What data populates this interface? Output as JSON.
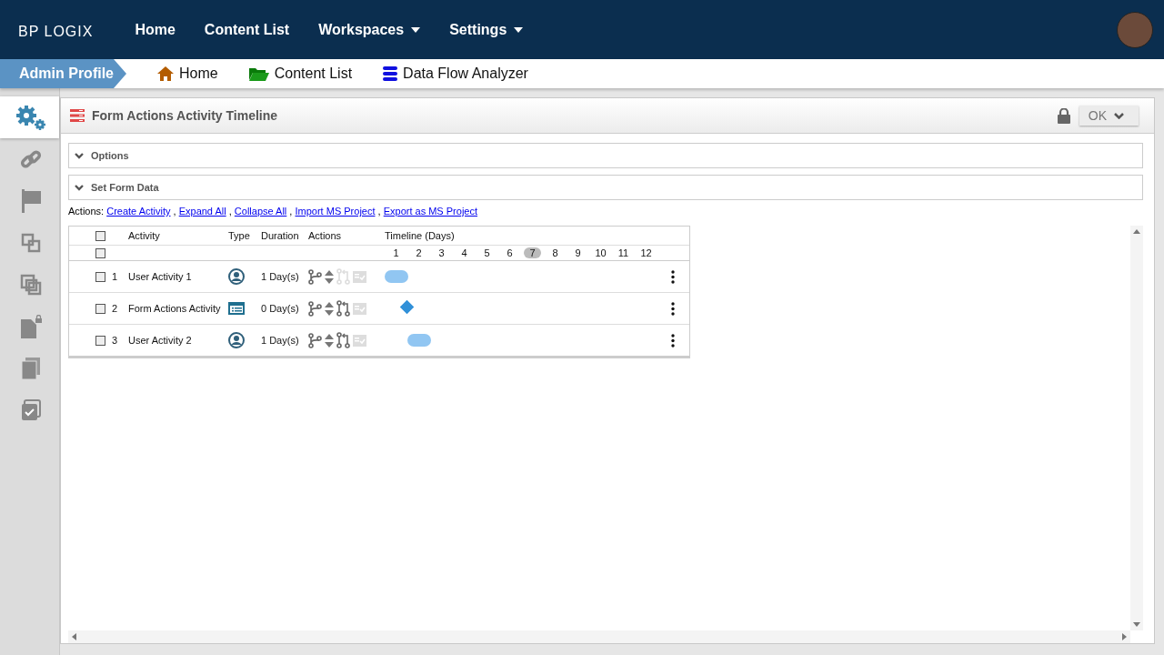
{
  "top_nav": {
    "logo": "BP LOGIX",
    "items": [
      {
        "label": "Home",
        "has_menu": false
      },
      {
        "label": "Content List",
        "has_menu": false
      },
      {
        "label": "Workspaces",
        "has_menu": true
      },
      {
        "label": "Settings",
        "has_menu": true
      }
    ]
  },
  "breadcrumb": {
    "profile": "Admin Profile",
    "links": [
      {
        "label": "Home",
        "kind": "home"
      },
      {
        "label": "Content List",
        "kind": "folder"
      },
      {
        "label": "Data Flow Analyzer",
        "kind": "database"
      }
    ]
  },
  "sidebar": {
    "items": [
      {
        "kind": "gears",
        "selected": true
      },
      {
        "kind": "link",
        "selected": false
      },
      {
        "kind": "flag",
        "selected": false
      },
      {
        "kind": "squares",
        "selected": false
      },
      {
        "kind": "squares2",
        "selected": false
      },
      {
        "kind": "filelock",
        "selected": false
      },
      {
        "kind": "copy",
        "selected": false
      },
      {
        "kind": "check",
        "selected": false
      }
    ]
  },
  "panel": {
    "title": "Form Actions Activity Timeline",
    "ok_button": "OK",
    "sections": [
      "Options",
      "Set Form Data"
    ],
    "actions_label": "Actions:",
    "actions_separator": ",",
    "actions": [
      "Create Activity",
      "Expand All",
      "Collapse All",
      "Import MS Project",
      "Export as MS Project"
    ],
    "table": {
      "columns": [
        "Activity",
        "Type",
        "Duration",
        "Actions",
        "Timeline (Days)"
      ],
      "header_checked": false,
      "subheader_checked": false,
      "days": [
        {
          "label": "1",
          "selected": false
        },
        {
          "label": "2",
          "selected": false
        },
        {
          "label": "3",
          "selected": false
        },
        {
          "label": "4",
          "selected": false
        },
        {
          "label": "5",
          "selected": false
        },
        {
          "label": "6",
          "selected": false
        },
        {
          "label": "7",
          "selected": true
        },
        {
          "label": "8",
          "selected": false
        },
        {
          "label": "9",
          "selected": false
        },
        {
          "label": "10",
          "selected": false
        },
        {
          "label": "11",
          "selected": false
        },
        {
          "label": "12",
          "selected": false
        }
      ],
      "rows": [
        {
          "checked": false,
          "number": "1",
          "activity": "User Activity 1",
          "kind": "user",
          "duration": "1 Day(s)",
          "link_enabled": false,
          "timeline_cells": [
            {
              "kind": "task"
            }
          ]
        },
        {
          "checked": false,
          "number": "2",
          "activity": "Form Actions Activity",
          "kind": "form",
          "duration": "0 Day(s)",
          "link_enabled": true,
          "timeline_cells": [
            {
              "kind": "milestone"
            }
          ]
        },
        {
          "checked": false,
          "number": "3",
          "activity": "User Activity 2",
          "kind": "user",
          "duration": "1 Day(s)",
          "link_enabled": true,
          "timeline_cells": [
            {
              "kind": "empty"
            },
            {
              "kind": "task"
            }
          ]
        }
      ]
    }
  }
}
